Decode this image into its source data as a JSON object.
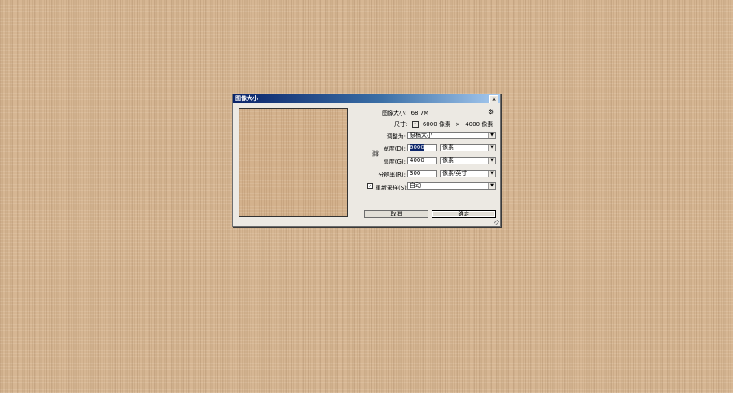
{
  "dialog": {
    "title": "图像大小",
    "close_label": "×",
    "image_size_label": "图像大小:",
    "image_size_value": "68.7M",
    "gear_icon": "⚙",
    "dimensions_label": "尺寸:",
    "dimensions_toggle": "-",
    "dimensions_width": "6000 像素",
    "dimensions_sep": "×",
    "dimensions_height": "4000 像素",
    "fit_to_label": "调整为:",
    "fit_to_value": "原稿大小",
    "link_icon": "⛓",
    "width_label": "宽度(D):",
    "width_value": "6000",
    "width_unit": "像素",
    "height_label": "高度(G):",
    "height_value": "4000",
    "height_unit": "像素",
    "resolution_label": "分辨率(R):",
    "resolution_value": "300",
    "resolution_unit": "像素/英寸",
    "resample_checked": "✓",
    "resample_label": "重新采样(S):",
    "resample_value": "自动",
    "dropdown_arrow": "▼",
    "cancel_label": "取消",
    "ok_label": "确定"
  }
}
